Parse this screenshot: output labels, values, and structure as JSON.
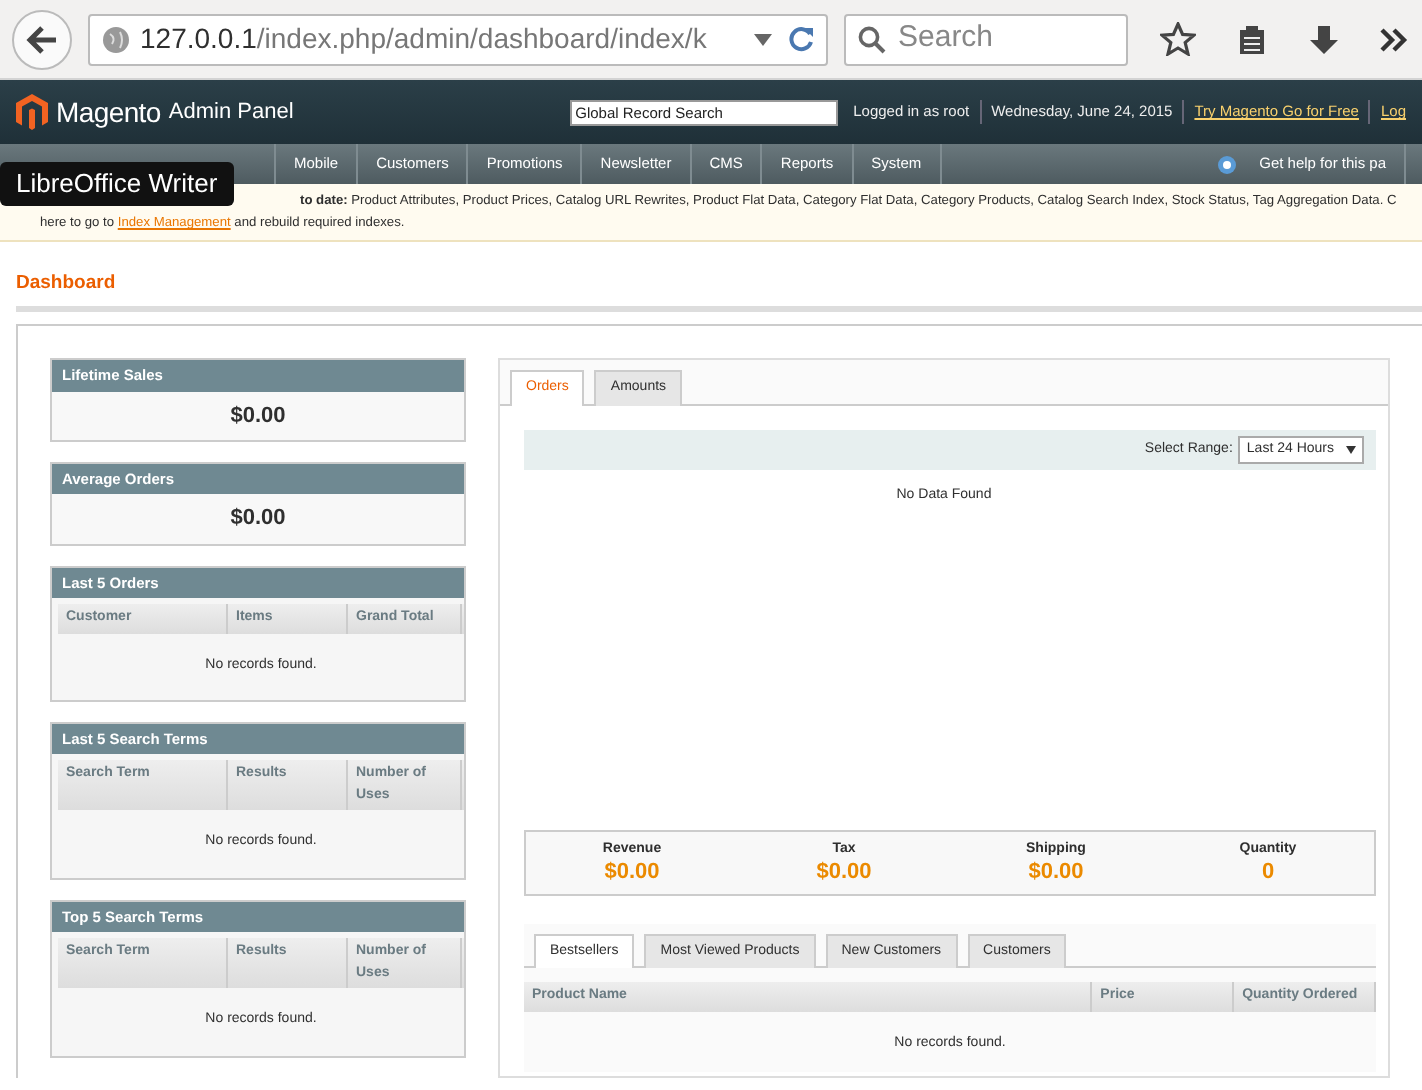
{
  "browser": {
    "url_host": "127.0.0.1",
    "url_path": "/index.php/admin/dashboard/index/k",
    "search_placeholder": "Search"
  },
  "header": {
    "brand": "Magento",
    "brand_sub": "Admin Panel",
    "search_placeholder": "Global Record Search",
    "user_text": "Logged in as root",
    "date": "Wednesday, June 24, 2015",
    "promo_link": "Try Magento Go for Free",
    "logout_link": "Log"
  },
  "nav": {
    "items": [
      {
        "label": "Mobile",
        "selected": false
      },
      {
        "label": "Customers",
        "selected": false
      },
      {
        "label": "Promotions",
        "selected": false
      },
      {
        "label": "Newsletter",
        "selected": false
      },
      {
        "label": "CMS",
        "selected": false
      },
      {
        "label": "Reports",
        "selected": false
      },
      {
        "label": "System",
        "selected": false
      }
    ],
    "help": "Get help for this pa"
  },
  "notice": {
    "line1": "**to date:** Product Attributes, Product Prices, Catalog URL Rewrites, Product Flat Data, Category Flat Data, Category Products, Catalog Search Index, Stock Status, Tag Aggregation Data. C",
    "line2_before": "here to go to",
    "link": "Index Management",
    "line2_after": "and rebuild required indexes."
  },
  "tooltip": "LibreOffice Writer",
  "page_title": "Dashboard",
  "widgets": [
    {
      "kind": "value",
      "title": "Lifetime Sales",
      "value": "$0.00"
    },
    {
      "kind": "value",
      "title": "Average Orders",
      "value": "$0.00"
    },
    {
      "kind": "table",
      "title": "Last 5 Orders",
      "columns": [
        "Customer",
        "Items",
        "Grand Total"
      ],
      "empty": "No records found."
    },
    {
      "kind": "table",
      "title": "Last 5 Search Terms",
      "columns": [
        "Search Term",
        "Results",
        "Number of Uses"
      ],
      "empty": "No records found."
    },
    {
      "kind": "table",
      "title": "Top 5 Search Terms",
      "columns": [
        "Search Term",
        "Results",
        "Number of Uses"
      ],
      "empty": "No records found."
    }
  ],
  "chart_panel": {
    "tabs": [
      {
        "label": "Orders",
        "selected": true
      },
      {
        "label": "Amounts",
        "selected": false
      }
    ],
    "range_label": "Select Range:",
    "range_value": "Last 24 Hours",
    "empty": "No Data Found"
  },
  "totals": [
    {
      "label": "Revenue",
      "value": "$0.00"
    },
    {
      "label": "Tax",
      "value": "$0.00"
    },
    {
      "label": "Shipping",
      "value": "$0.00"
    },
    {
      "label": "Quantity",
      "value": "0"
    }
  ],
  "grid_panel": {
    "tabs": [
      {
        "label": "Bestsellers",
        "selected": true
      },
      {
        "label": "Most Viewed Products",
        "selected": false
      },
      {
        "label": "New Customers",
        "selected": false
      },
      {
        "label": "Customers",
        "selected": false
      }
    ],
    "columns": [
      "Product Name",
      "Price",
      "Quantity Ordered"
    ],
    "empty": "No records found."
  }
}
